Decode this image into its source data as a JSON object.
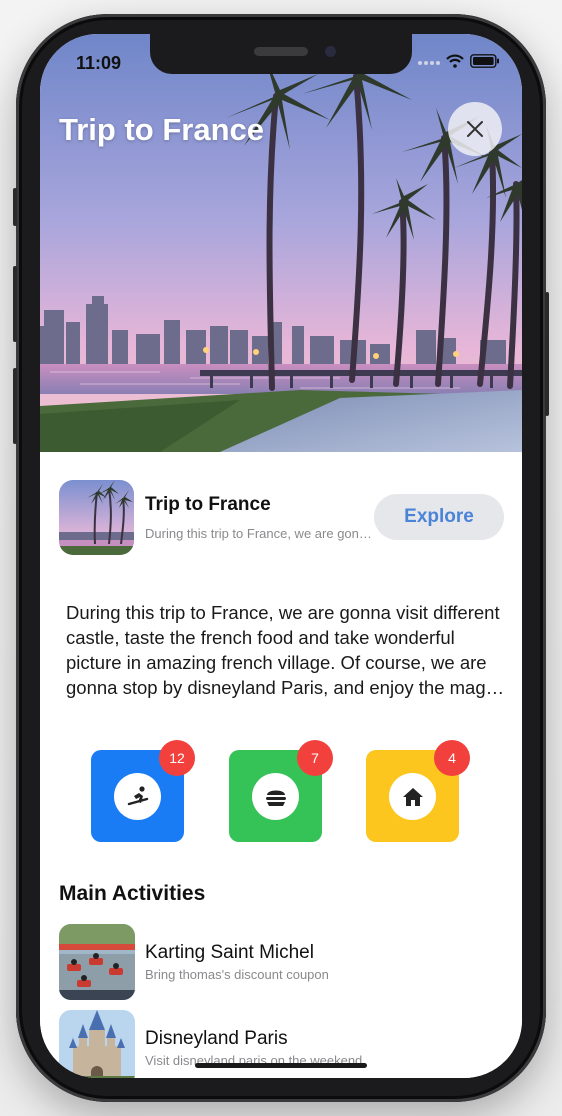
{
  "status_bar": {
    "time": "11:09"
  },
  "hero": {
    "title": "Trip to France"
  },
  "summary": {
    "title": "Trip to France",
    "subtitle": "During this trip to France, we are gonna visit different castle",
    "explore_label": "Explore"
  },
  "description": "During this trip to France, we are gonna visit different castle, taste the french food and take wonderful picture in amazing french village. Of course, we are gonna stop by disneyland Paris, and enjoy the magic of the parks with the whole family.",
  "categories": [
    {
      "icon": "snowboarding-icon",
      "count": "12",
      "color": "#1a7cf5"
    },
    {
      "icon": "burger-icon",
      "count": "7",
      "color": "#35c257"
    },
    {
      "icon": "home-icon",
      "count": "4",
      "color": "#fcc61f"
    }
  ],
  "activities_section": {
    "title": "Main Activities",
    "items": [
      {
        "title": "Karting Saint Michel",
        "subtitle": "Bring thomas's discount coupon"
      },
      {
        "title": "Disneyland Paris",
        "subtitle": "Visit disneyland paris on the weekend"
      }
    ]
  }
}
